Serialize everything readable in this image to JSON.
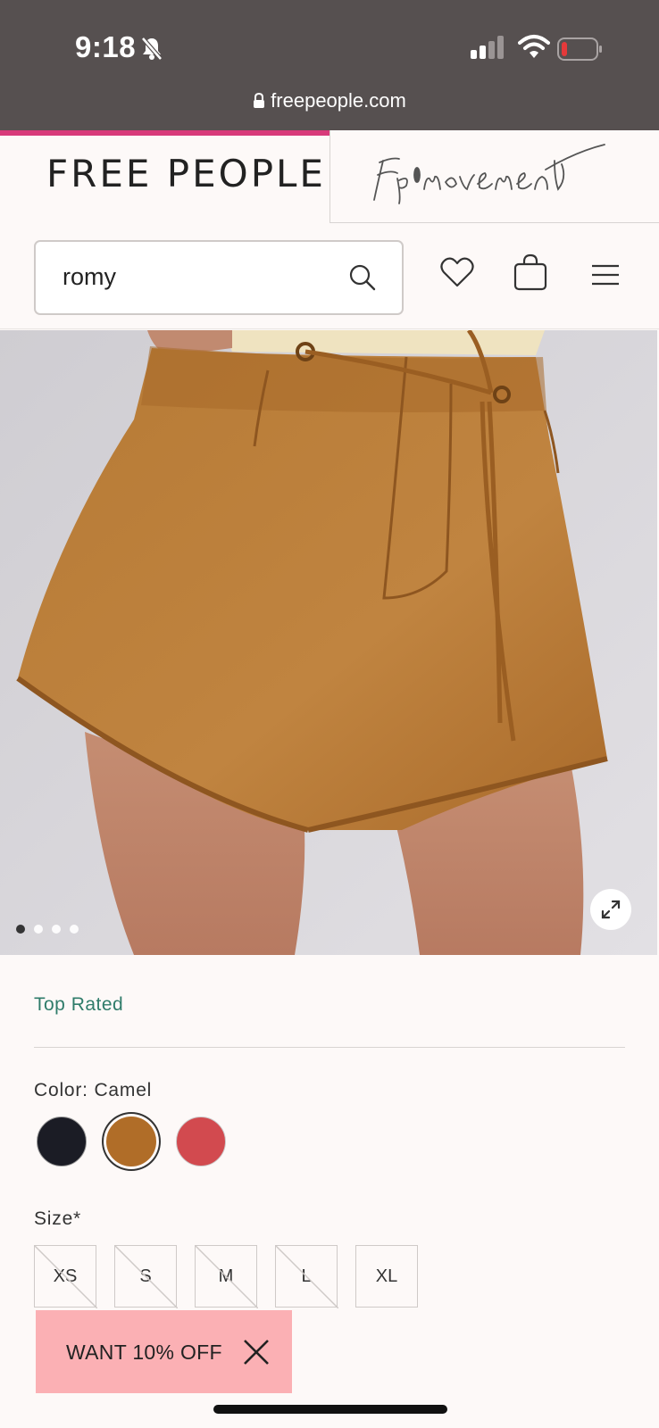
{
  "status_bar": {
    "time": "9:18"
  },
  "browser": {
    "url": "freepeople.com"
  },
  "header": {
    "brand": "FREE PEOPLE",
    "sub_brand_logo": "fp movement"
  },
  "search": {
    "value": "romy"
  },
  "gallery": {
    "image_count": 4,
    "active_index": 0
  },
  "product": {
    "badge": "Top Rated",
    "color_label": "Color: Camel",
    "colors": [
      {
        "name": "Black",
        "hex": "#1b1c25",
        "selected": false
      },
      {
        "name": "Camel",
        "hex": "#b06d28",
        "selected": true
      },
      {
        "name": "Red",
        "hex": "#d24a4f",
        "selected": false
      }
    ],
    "size_label": "Size*",
    "sizes": [
      {
        "label": "XS",
        "available": false
      },
      {
        "label": "S",
        "available": false
      },
      {
        "label": "M",
        "available": false
      },
      {
        "label": "L",
        "available": false
      },
      {
        "label": "XL",
        "available": true
      }
    ]
  },
  "promo": {
    "text": "WANT 10% OFF"
  },
  "colors": {
    "accent": "#d83a7a",
    "top_rated": "#2f7c6a",
    "promo_bg": "#fbb0b4"
  }
}
